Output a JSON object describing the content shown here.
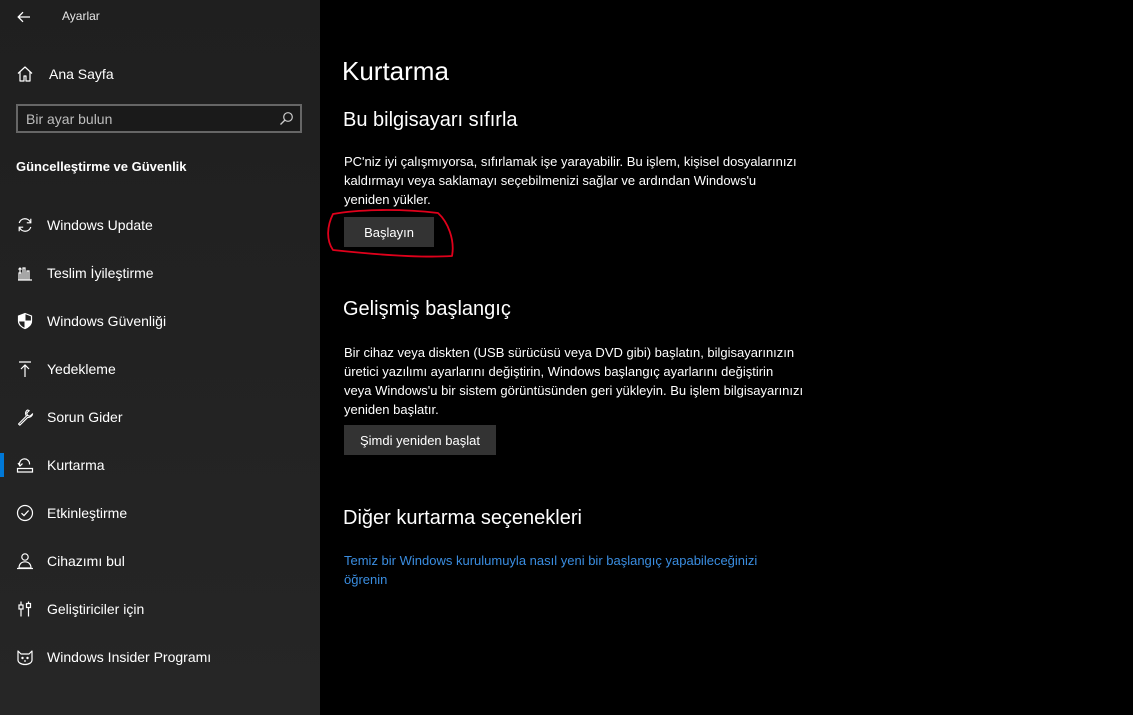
{
  "window": {
    "title": "Ayarlar"
  },
  "sidebar": {
    "home_label": "Ana Sayfa",
    "search_placeholder": "Bir ayar bulun",
    "section_title": "Güncelleştirme ve Güvenlik",
    "items": [
      {
        "label": "Windows Update",
        "icon": "refresh-icon"
      },
      {
        "label": "Teslim İyileştirme",
        "icon": "delivery-optimization-icon"
      },
      {
        "label": "Windows Güvenliği",
        "icon": "shield-icon"
      },
      {
        "label": "Yedekleme",
        "icon": "upload-arrow-icon"
      },
      {
        "label": "Sorun Gider",
        "icon": "wrench-icon"
      },
      {
        "label": "Kurtarma",
        "icon": "recovery-icon",
        "active": true
      },
      {
        "label": "Etkinleştirme",
        "icon": "checkmark-circle-icon"
      },
      {
        "label": "Cihazımı bul",
        "icon": "person-location-icon"
      },
      {
        "label": "Geliştiriciler için",
        "icon": "developer-tools-icon"
      },
      {
        "label": "Windows Insider Programı",
        "icon": "insider-cat-icon"
      }
    ]
  },
  "main": {
    "title": "Kurtarma",
    "reset": {
      "heading": "Bu bilgisayarı sıfırla",
      "description": "PC'niz iyi çalışmıyorsa, sıfırlamak işe yarayabilir. Bu işlem, kişisel dosyalarınızı kaldırmayı veya saklamayı seçebilmenizi sağlar ve ardından Windows'u yeniden yükler.",
      "button": "Başlayın"
    },
    "advanced": {
      "heading": "Gelişmiş başlangıç",
      "description": "Bir cihaz veya diskten (USB sürücüsü veya DVD gibi) başlatın, bilgisayarınızın üretici yazılımı ayarlarını değiştirin, Windows başlangıç ayarlarını değiştirin veya Windows'u bir sistem görüntüsünden geri yükleyin. Bu işlem bilgisayarınızı yeniden başlatır.",
      "button": "Şimdi yeniden başlat"
    },
    "more": {
      "heading": "Diğer kurtarma seçenekleri",
      "link": "Temiz bir Windows kurulumuyla nasıl yeni bir başlangıç yapabileceğinizi öğrenin"
    }
  },
  "colors": {
    "accent": "#0078d7",
    "link": "#3a8de0",
    "annotation": "#e0001b"
  }
}
